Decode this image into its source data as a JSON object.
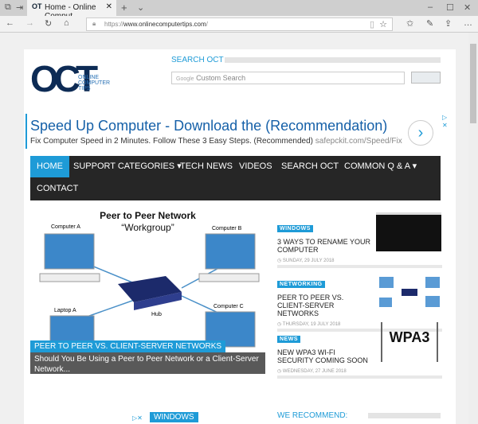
{
  "browser": {
    "tab_title": "Home - Online Comput",
    "url_prefix": "https://",
    "url_domain": "www.onlinecomputertips.com",
    "url_suffix": "/"
  },
  "header": {
    "logo_text": "OCT",
    "logo_sub": "ONLINE COMPUTER TIPS",
    "search_heading": "SEARCH OCT",
    "search_placeholder_brand": "Google",
    "search_placeholder": "Custom Search"
  },
  "ad": {
    "title": "Speed Up Computer - Download the (Recommendation)",
    "text": "Fix Computer Speed in 2 Minutes. Follow These 3 Easy Steps. (Recommended)",
    "link": "safepckit.com/Speed/Fix"
  },
  "nav": {
    "items": [
      {
        "label": "HOME"
      },
      {
        "label": "SUPPORT CATEGORIES ▾"
      },
      {
        "label": "TECH NEWS"
      },
      {
        "label": "VIDEOS"
      },
      {
        "label": "SEARCH OCT"
      },
      {
        "label": "COMMON Q & A ▾"
      },
      {
        "label": "CONTACT"
      }
    ]
  },
  "featured": {
    "image_title": "Peer to Peer Network",
    "image_subtitle": "“Workgroup”",
    "labels": [
      "Computer A",
      "Computer B",
      "Laptop A",
      "Hub",
      "Computer C"
    ],
    "category": "PEER TO PEER VS. CLIENT-SERVER NETWORKS",
    "excerpt": "Should You Be Using a Peer to Peer Network or a Client-Server Network..."
  },
  "posts": [
    {
      "category": "WINDOWS",
      "title": "3 WAYS TO RENAME YOUR COMPUTER",
      "date": "SUNDAY, 29 JULY 2018"
    },
    {
      "category": "NETWORKING",
      "title": "PEER TO PEER VS. CLIENT-SERVER NETWORKS",
      "date": "THURSDAY, 19 JULY 2018"
    },
    {
      "category": "NEWS",
      "title": "NEW WPA3 WI-FI SECURITY COMING SOON",
      "date": "WEDNESDAY, 27 JUNE 2018",
      "thumb_text": "WPA3"
    }
  ],
  "bottom": {
    "category": "WINDOWS",
    "recommend": "WE RECOMMEND:"
  },
  "colors": {
    "accent": "#1e9bd7",
    "nav_bg": "#262626"
  }
}
